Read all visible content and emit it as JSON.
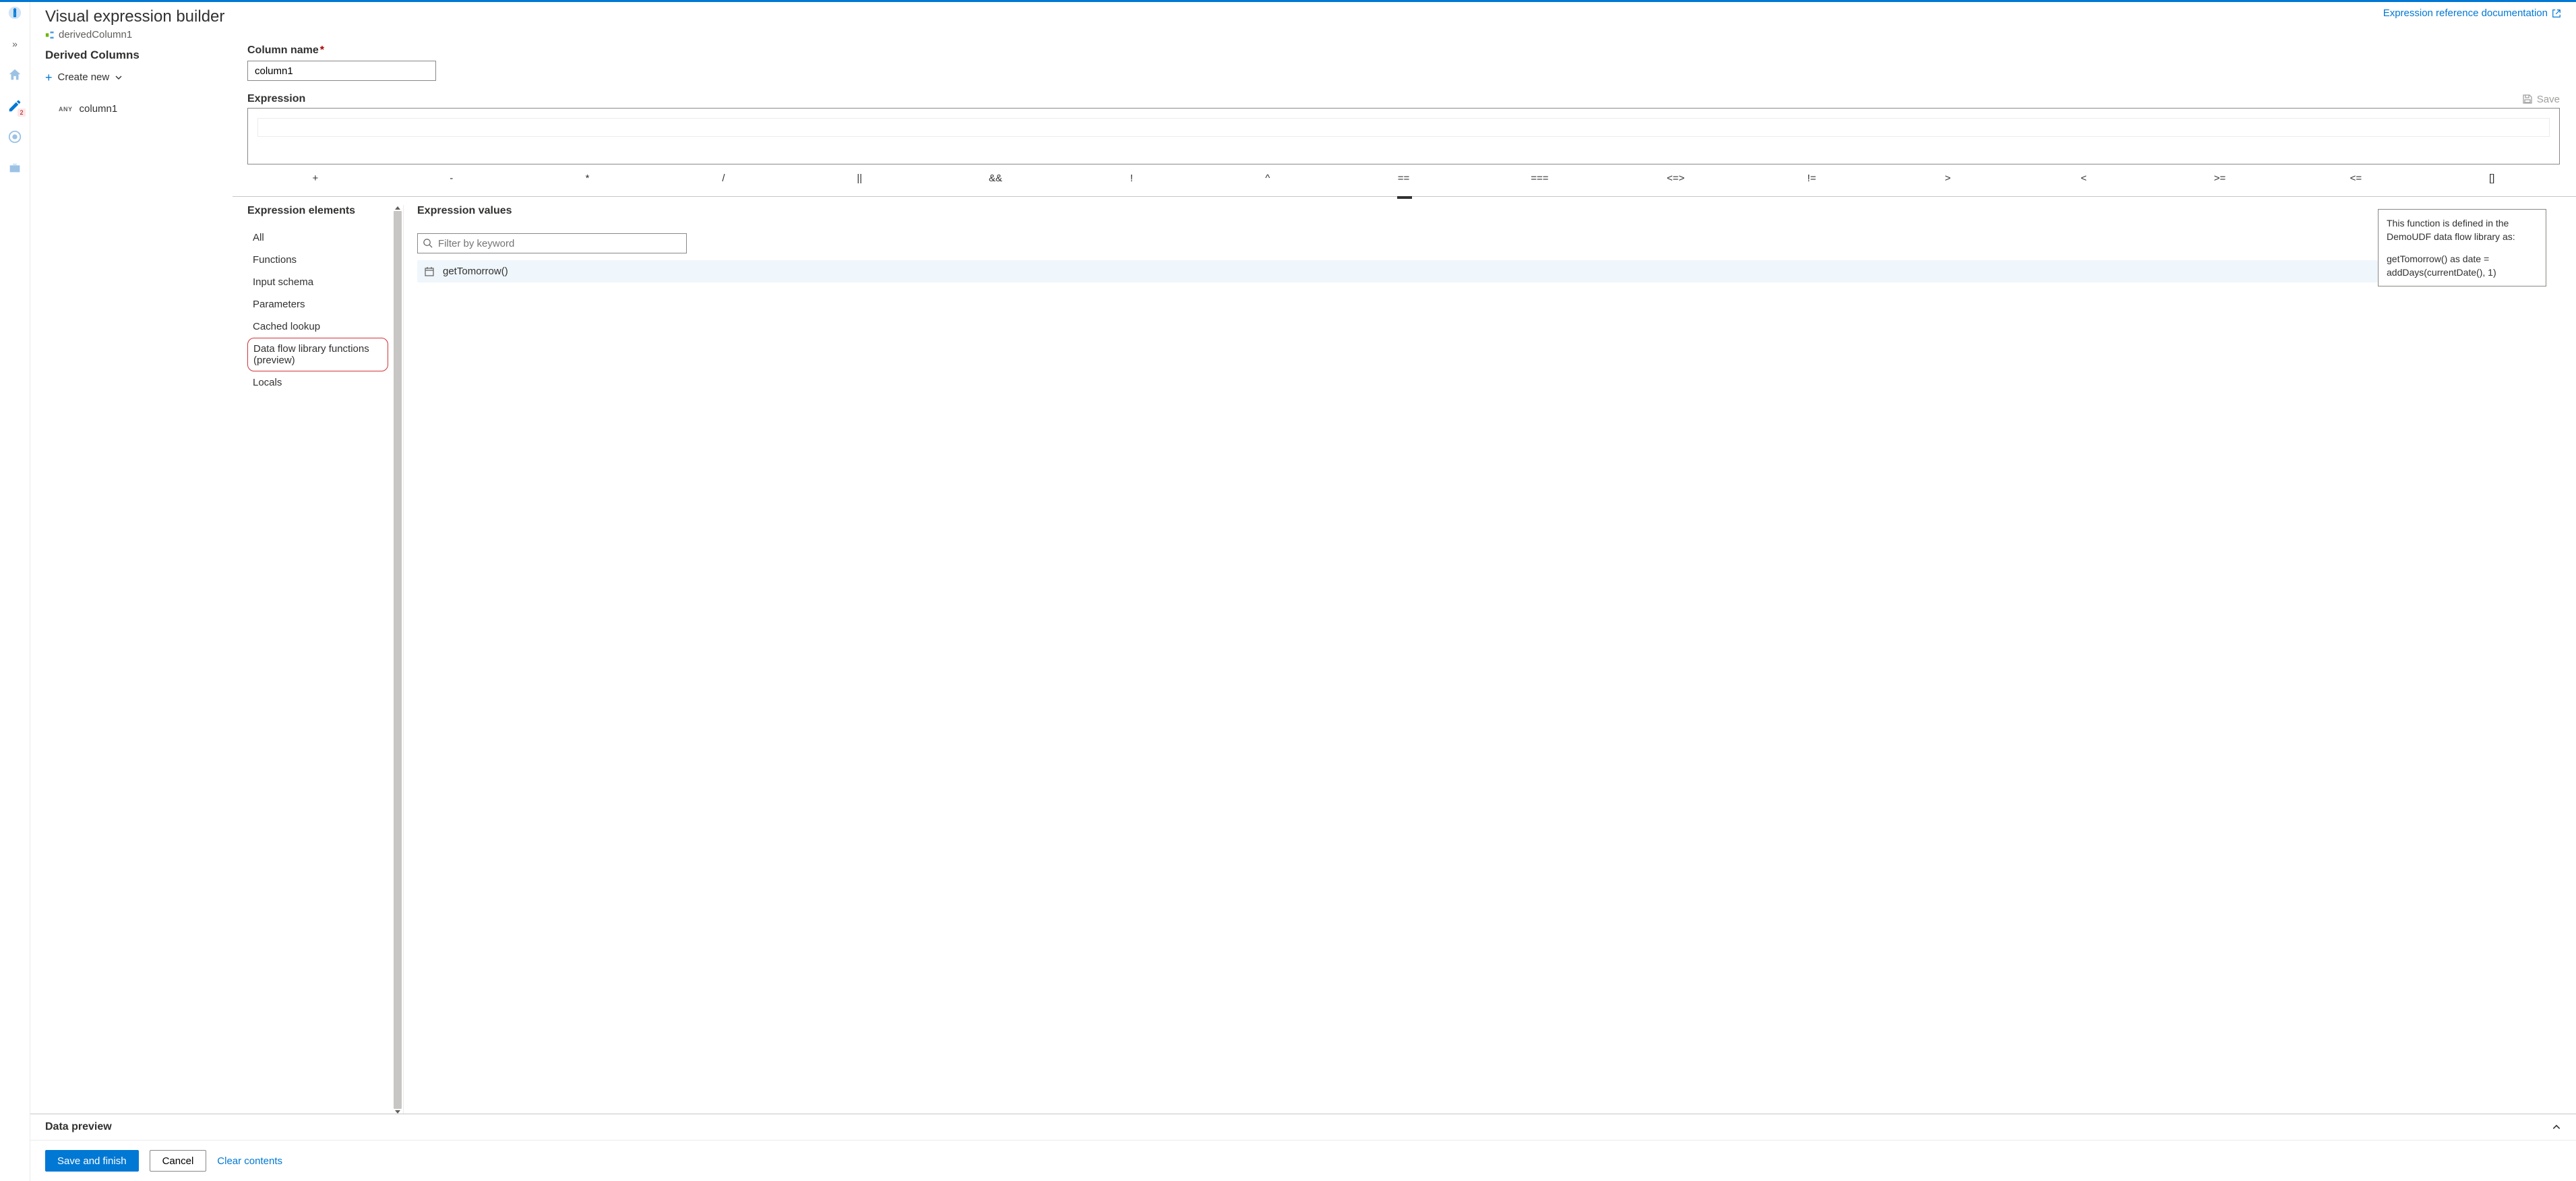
{
  "rail": {
    "expand": "»",
    "pencil_badge": "2"
  },
  "header": {
    "title": "Visual expression builder",
    "crumb": "derivedColumn1",
    "doc_link": "Expression reference documentation"
  },
  "left": {
    "heading": "Derived Columns",
    "create_new": "Create new",
    "columns": [
      {
        "type": "ANY",
        "name": "column1"
      }
    ]
  },
  "fields": {
    "column_name_label": "Column name",
    "column_name_value": "column1",
    "expression_label": "Expression",
    "save_label": "Save"
  },
  "operators": [
    "+",
    "-",
    "*",
    "/",
    "||",
    "&&",
    "!",
    "^",
    "==",
    "===",
    "<=>",
    "!=",
    ">",
    "<",
    ">=",
    "<=",
    "[]"
  ],
  "elements": {
    "heading": "Expression elements",
    "items": [
      {
        "label": "All"
      },
      {
        "label": "Functions"
      },
      {
        "label": "Input schema"
      },
      {
        "label": "Parameters"
      },
      {
        "label": "Cached lookup"
      },
      {
        "label": "Data flow library functions (preview)",
        "highlight": true
      },
      {
        "label": "Locals"
      }
    ]
  },
  "values": {
    "heading": "Expression values",
    "filter_placeholder": "Filter by keyword",
    "rows": [
      {
        "name": "getTomorrow()"
      }
    ]
  },
  "tooltip": {
    "line1": "This function is defined in the DemoUDF data flow library as:",
    "line2": "getTomorrow() as date = addDays(currentDate(), 1)"
  },
  "preview": {
    "label": "Data preview"
  },
  "footer": {
    "save_finish": "Save and finish",
    "cancel": "Cancel",
    "clear": "Clear contents"
  }
}
